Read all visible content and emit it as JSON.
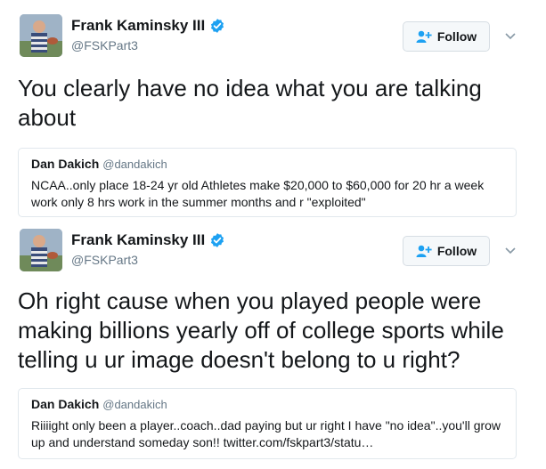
{
  "tweets": [
    {
      "author": {
        "display_name": "Frank Kaminsky III",
        "handle": "@FSKPart3",
        "verified": true
      },
      "follow_label": "Follow",
      "text": "You clearly have no idea what you are talking about",
      "quote": {
        "display_name": "Dan Dakich",
        "handle": "@dandakich",
        "text": "NCAA..only place 18-24 yr old Athletes make $20,000 to $60,000 for 20 hr a week work only 8 hrs work in the summer months and r \"exploited\""
      }
    },
    {
      "author": {
        "display_name": "Frank Kaminsky III",
        "handle": "@FSKPart3",
        "verified": true
      },
      "follow_label": "Follow",
      "text": "Oh right cause when you played people were making billions yearly off of college sports while telling u ur image doesn't belong to u right?",
      "quote": {
        "display_name": "Dan Dakich",
        "handle": "@dandakich",
        "text": "Riiiight only been a player..coach..dad paying but ur right I have \"no idea\"..you'll grow up and understand someday son!! twitter.com/fskpart3/statu…"
      }
    }
  ],
  "colors": {
    "verified_blue": "#1da1f2",
    "follow_icon_blue": "#1da1f2",
    "muted": "#657786",
    "border": "#e1e8ed"
  },
  "icons": {
    "verified": "verified-badge-icon",
    "follow": "add-person-icon",
    "caret": "chevron-down-icon"
  }
}
